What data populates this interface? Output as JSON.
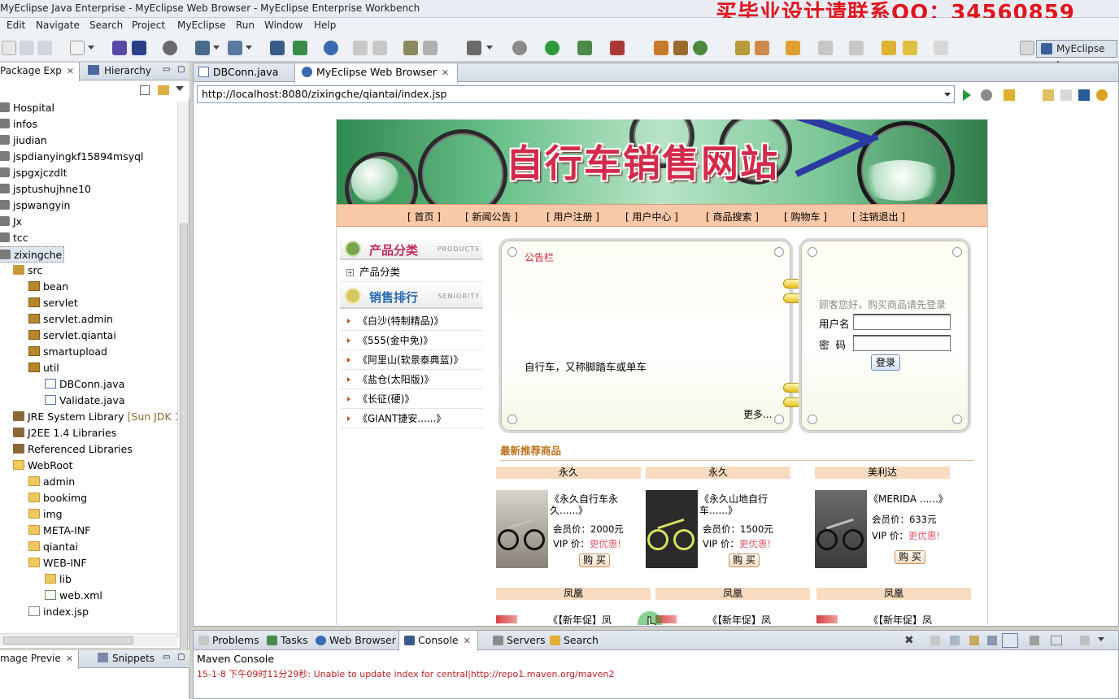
{
  "window": {
    "title": "MyEclipse Java Enterprise - MyEclipse Web Browser - MyEclipse Enterprise Workbench",
    "watermark": "买毕业设计请联系QQ：34560859"
  },
  "menu": [
    "Edit",
    "Navigate",
    "Search",
    "Project",
    "MyEclipse",
    "Run",
    "Window",
    "Help"
  ],
  "perspective": "MyEclipse J...",
  "left_panel": {
    "tabs": [
      "Package Exp",
      "Hierarchy"
    ],
    "tree": [
      {
        "label": "Hospital",
        "icon": "project-icon",
        "depth": 0
      },
      {
        "label": "infos",
        "icon": "project-icon",
        "depth": 0
      },
      {
        "label": "jiudian",
        "icon": "project-icon",
        "depth": 0
      },
      {
        "label": "jspdianyingkf15894msyql",
        "icon": "project-icon",
        "depth": 0
      },
      {
        "label": "jspgxjczdlt",
        "icon": "project-icon",
        "depth": 0
      },
      {
        "label": "jsptushujhne10",
        "icon": "project-icon",
        "depth": 0
      },
      {
        "label": "jspwangyin",
        "icon": "project-icon",
        "depth": 0
      },
      {
        "label": "Jx",
        "icon": "project-icon",
        "depth": 0
      },
      {
        "label": "tcc",
        "icon": "project-icon",
        "depth": 0
      },
      {
        "label": "zixingche",
        "icon": "project-icon",
        "depth": 0,
        "selected": true
      },
      {
        "label": "src",
        "icon": "source-folder-icon",
        "depth": 1
      },
      {
        "label": "bean",
        "icon": "package-icon",
        "depth": 2
      },
      {
        "label": "servlet",
        "icon": "package-icon",
        "depth": 2
      },
      {
        "label": "servlet.admin",
        "icon": "package-icon",
        "depth": 2
      },
      {
        "label": "servlet.qiantai",
        "icon": "package-icon",
        "depth": 2
      },
      {
        "label": "smartupload",
        "icon": "package-icon",
        "depth": 2
      },
      {
        "label": "util",
        "icon": "package-icon",
        "depth": 2
      },
      {
        "label": "DBConn.java",
        "icon": "java-file-icon",
        "depth": 3
      },
      {
        "label": "Validate.java",
        "icon": "java-file-icon",
        "depth": 3
      },
      {
        "label": "JRE System Library",
        "suffix": "[Sun JDK 1.",
        "icon": "library-icon",
        "depth": 1
      },
      {
        "label": "J2EE 1.4 Libraries",
        "icon": "library-icon",
        "depth": 1
      },
      {
        "label": "Referenced Libraries",
        "icon": "library-icon",
        "depth": 1
      },
      {
        "label": "WebRoot",
        "icon": "folder-icon",
        "depth": 1
      },
      {
        "label": "admin",
        "icon": "folder-icon",
        "depth": 2
      },
      {
        "label": "bookimg",
        "icon": "folder-icon",
        "depth": 2
      },
      {
        "label": "img",
        "icon": "folder-icon",
        "depth": 2
      },
      {
        "label": "META-INF",
        "icon": "folder-icon",
        "depth": 2
      },
      {
        "label": "qiantai",
        "icon": "folder-icon",
        "depth": 2
      },
      {
        "label": "WEB-INF",
        "icon": "folder-icon",
        "depth": 2
      },
      {
        "label": "lib",
        "icon": "folder-icon",
        "depth": 3
      },
      {
        "label": "web.xml",
        "icon": "xml-file-icon",
        "depth": 3
      },
      {
        "label": "index.jsp",
        "icon": "jsp-file-icon",
        "depth": 2
      }
    ],
    "bottom_tabs": [
      "mage Previe",
      "Snippets"
    ]
  },
  "editor": {
    "tabs": [
      "DBConn.java",
      "MyEclipse Web Browser"
    ],
    "url": "http://localhost:8080/zixingche/qiantai/index.jsp"
  },
  "site": {
    "banner_title": "自行车销售网站",
    "nav": [
      "[ 首页 ]",
      "[ 新闻公告 ]",
      "[ 用户注册 ]",
      "[ 用户中心 ]",
      "[ 商品搜索 ]",
      "[ 购物车 ]",
      "[ 注销退出 ]"
    ],
    "category_header": "产品分类",
    "category_header_en": "PRODUCTS",
    "category_item": "产品分类",
    "rank_header": "销售排行",
    "rank_header_en": "SENIORITY",
    "rank_items": [
      "《白沙(特制精品)》",
      "《555(金中免)》",
      "《阿里山(软景泰典蓝)》",
      "《盐仓(太阳版)》",
      "《长征(硬)》",
      "《GIANT捷安......》"
    ],
    "notice": {
      "title": "公告栏",
      "body": "自行车，又称脚踏车或单车",
      "more": "更多..."
    },
    "login": {
      "hint": "顾客您好，购买商品请先登录",
      "username_label": "用户名",
      "password_label": "密  码",
      "submit": "登录"
    },
    "recommend_title": "最新推荐商品",
    "products": [
      {
        "brand": "永久",
        "name": "《永久自行车永久......》",
        "price": "会员价：2000元",
        "vip_label": "VIP 价：",
        "vip_value": "更优惠!",
        "buy": "购 买"
      },
      {
        "brand": "永久",
        "name": "《永久山地自行车......》",
        "price": "会员价：1500元",
        "vip_label": "VIP 价：",
        "vip_value": "更优惠!",
        "buy": "购 买"
      },
      {
        "brand": "美利达",
        "name": "《MERIDA ......》",
        "price": "会员价：633元",
        "vip_label": "VIP 价：",
        "vip_value": "更优惠!",
        "buy": "购 买"
      }
    ],
    "second_row": [
      {
        "brand": "凤凰",
        "name": "《【新年促】凤"
      },
      {
        "brand": "凤凰",
        "name": "《【新年促】凤"
      },
      {
        "brand": "凤凰",
        "name": "《【新年促】凤"
      }
    ]
  },
  "bottom_panel": {
    "tabs": [
      "Problems",
      "Tasks",
      "Web Browser",
      "Console",
      "Servers",
      "Search"
    ],
    "console_title": "Maven Console",
    "console_line": "15-1-8 下午09时11分29秒: Unable to update index for central|http://repo1.maven.org/maven2"
  }
}
